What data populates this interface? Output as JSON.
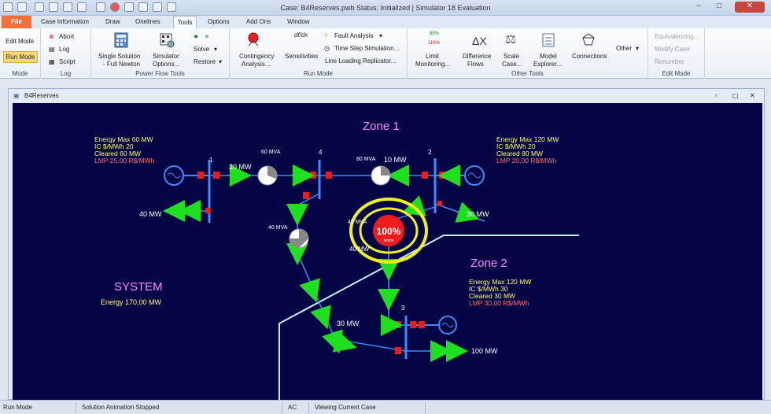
{
  "title": "Case: B4Reserves.pwb  Status: Initialized | Simulator 18 Evaluation",
  "tabs": [
    "Case Information",
    "Draw",
    "Onelines",
    "Tools",
    "Options",
    "Add Ons",
    "Window"
  ],
  "file_tab": "File",
  "ribbon": {
    "mode": {
      "edit": "Edit Mode",
      "run": "Run Mode",
      "label": "Mode"
    },
    "log": {
      "abort": "Abort",
      "log": "Log",
      "script": "Script",
      "label": "Log"
    },
    "pft": {
      "single_line1": "Single Solution",
      "single_line2": "- Full Newton",
      "sim_line1": "Simulator",
      "sim_line2": "Options...",
      "solve": "Solve",
      "restore": "Restore",
      "label": "Power Flow Tools"
    },
    "run": {
      "cont_line1": "Contingency",
      "cont_line2": "Analysis...",
      "sens": "Sensitivities",
      "fault": "Fault Analysis",
      "timestep": "Time Step Simulation...",
      "llr": "Line Loading Replicator...",
      "label": "Run Mode"
    },
    "other": {
      "limit_line1": "Limit",
      "limit_line2": "Monitoring...",
      "limit_pct1": "85%",
      "limit_pct2": "110%",
      "diff_line1": "Difference",
      "diff_line2": "Flows",
      "scale_line1": "Scale",
      "scale_line2": "Case...",
      "model_line1": "Model",
      "model_line2": "Explorer...",
      "connections": "Connections",
      "other": "Other",
      "label": "Other Tools",
      "delta": "ΔX"
    },
    "edit": {
      "equiv": "Equivalencing...",
      "modify": "Modify Case",
      "renumber": "Renumber",
      "label": "Edit Mode"
    }
  },
  "doc_title": "B4Reserves",
  "oneline": {
    "zone1": "Zone 1",
    "zone2": "Zone 2",
    "system": "SYSTEM",
    "system_energy": "Energy   170,00 MW",
    "bus1": "1",
    "bus2": "2",
    "bus3": "3",
    "bus4": "4",
    "gen1": {
      "l1": "Energy Max   60 MW",
      "l2": "IC $/MWh      20",
      "l3": "Cleared        60 MW",
      "l4": "LMP            25,00 R$/MWh"
    },
    "gen2": {
      "l1": "Energy Max   120 MW",
      "l2": "IC $/MWh      20",
      "l3": "Cleared        80 MW",
      "l4": "LMP            20,00 R$/MWh"
    },
    "gen3": {
      "l1": "Energy Max   120 MW",
      "l2": "IC $/MWh      30",
      "l3": "Cleared        30 MW",
      "l4": "LMP            30,00 R$/MWh"
    },
    "flow_1_4": "20 MW",
    "flow_2_4": "10 MW",
    "flow_4_3": "30 MW",
    "load1": "40 MW",
    "load2": "30 MW",
    "load3": "100 MW",
    "mva60a": "60 MVA",
    "mva80": "80 MVA",
    "mva40": "40 MVA",
    "mva40b": "40 MVA",
    "mva40c": "40 MW",
    "overload_pct": "100%",
    "overload_unit": "Amps"
  },
  "status": {
    "mode": "Run Mode",
    "anim": "Solution Animation Stopped",
    "ac": "AC",
    "viewing": "Viewing Current Case"
  },
  "colors": {
    "canvas": "#050545",
    "bus": "#3a8cff",
    "arrow": "#1ee01e",
    "breaker": "#ee1c1c",
    "zone_line": "#bfeeff",
    "highlight": "#f0f01a",
    "text_yellow": "#ffff66",
    "text_lmp": "#ff6a6a",
    "zone_text": "#ff88ff"
  }
}
